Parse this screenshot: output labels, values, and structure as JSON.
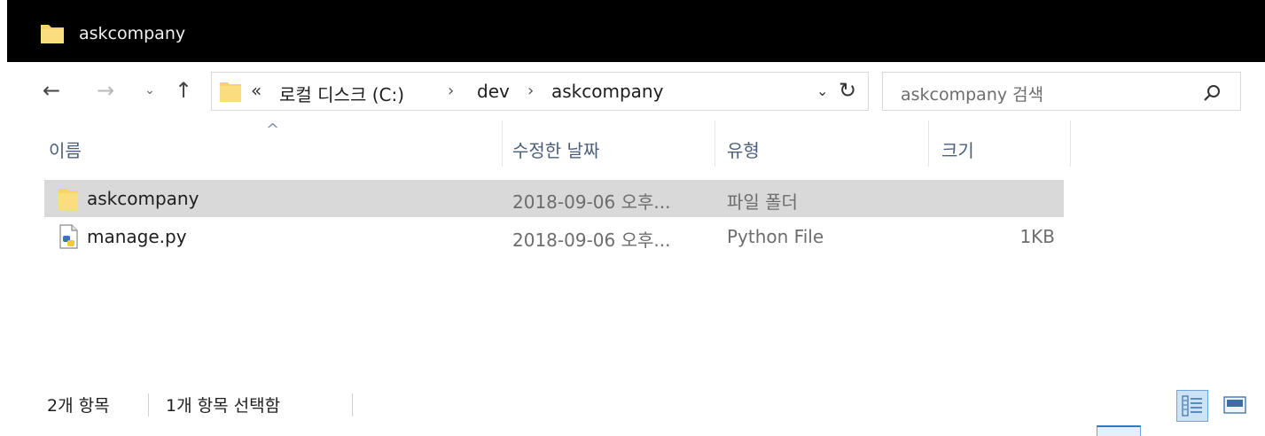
{
  "window": {
    "title": "askcompany",
    "icon": "folder-icon"
  },
  "nav": {
    "back_icon": "←",
    "forward_icon": "→",
    "recent_icon": "⌄",
    "up_icon": "↑"
  },
  "address": {
    "more": "«",
    "crumbs": [
      "로컬 디스크 (C:)",
      "dev",
      "askcompany"
    ],
    "separator": "›",
    "dropdown_icon": "⌄",
    "refresh_icon": "↻"
  },
  "search": {
    "placeholder": "askcompany 검색"
  },
  "columns": {
    "name": "이름",
    "date": "수정한 날짜",
    "type": "유형",
    "size": "크기",
    "sort_icon": "^"
  },
  "files": [
    {
      "name": "askcompany",
      "date": "2018-09-06 오후...",
      "type": "파일 폴더",
      "size": "",
      "icon": "folder-icon",
      "selected": true
    },
    {
      "name": "manage.py",
      "date": "2018-09-06 오후...",
      "type": "Python File",
      "size": "1KB",
      "icon": "python-file-icon",
      "selected": false
    }
  ],
  "status": {
    "count": "2개 항목",
    "selection": "1개 항목 선택함"
  },
  "colors": {
    "accent": "#6aa7de",
    "folder": "#f6d36b",
    "selection": "#d9d9d9",
    "header_text": "#4c607a"
  }
}
